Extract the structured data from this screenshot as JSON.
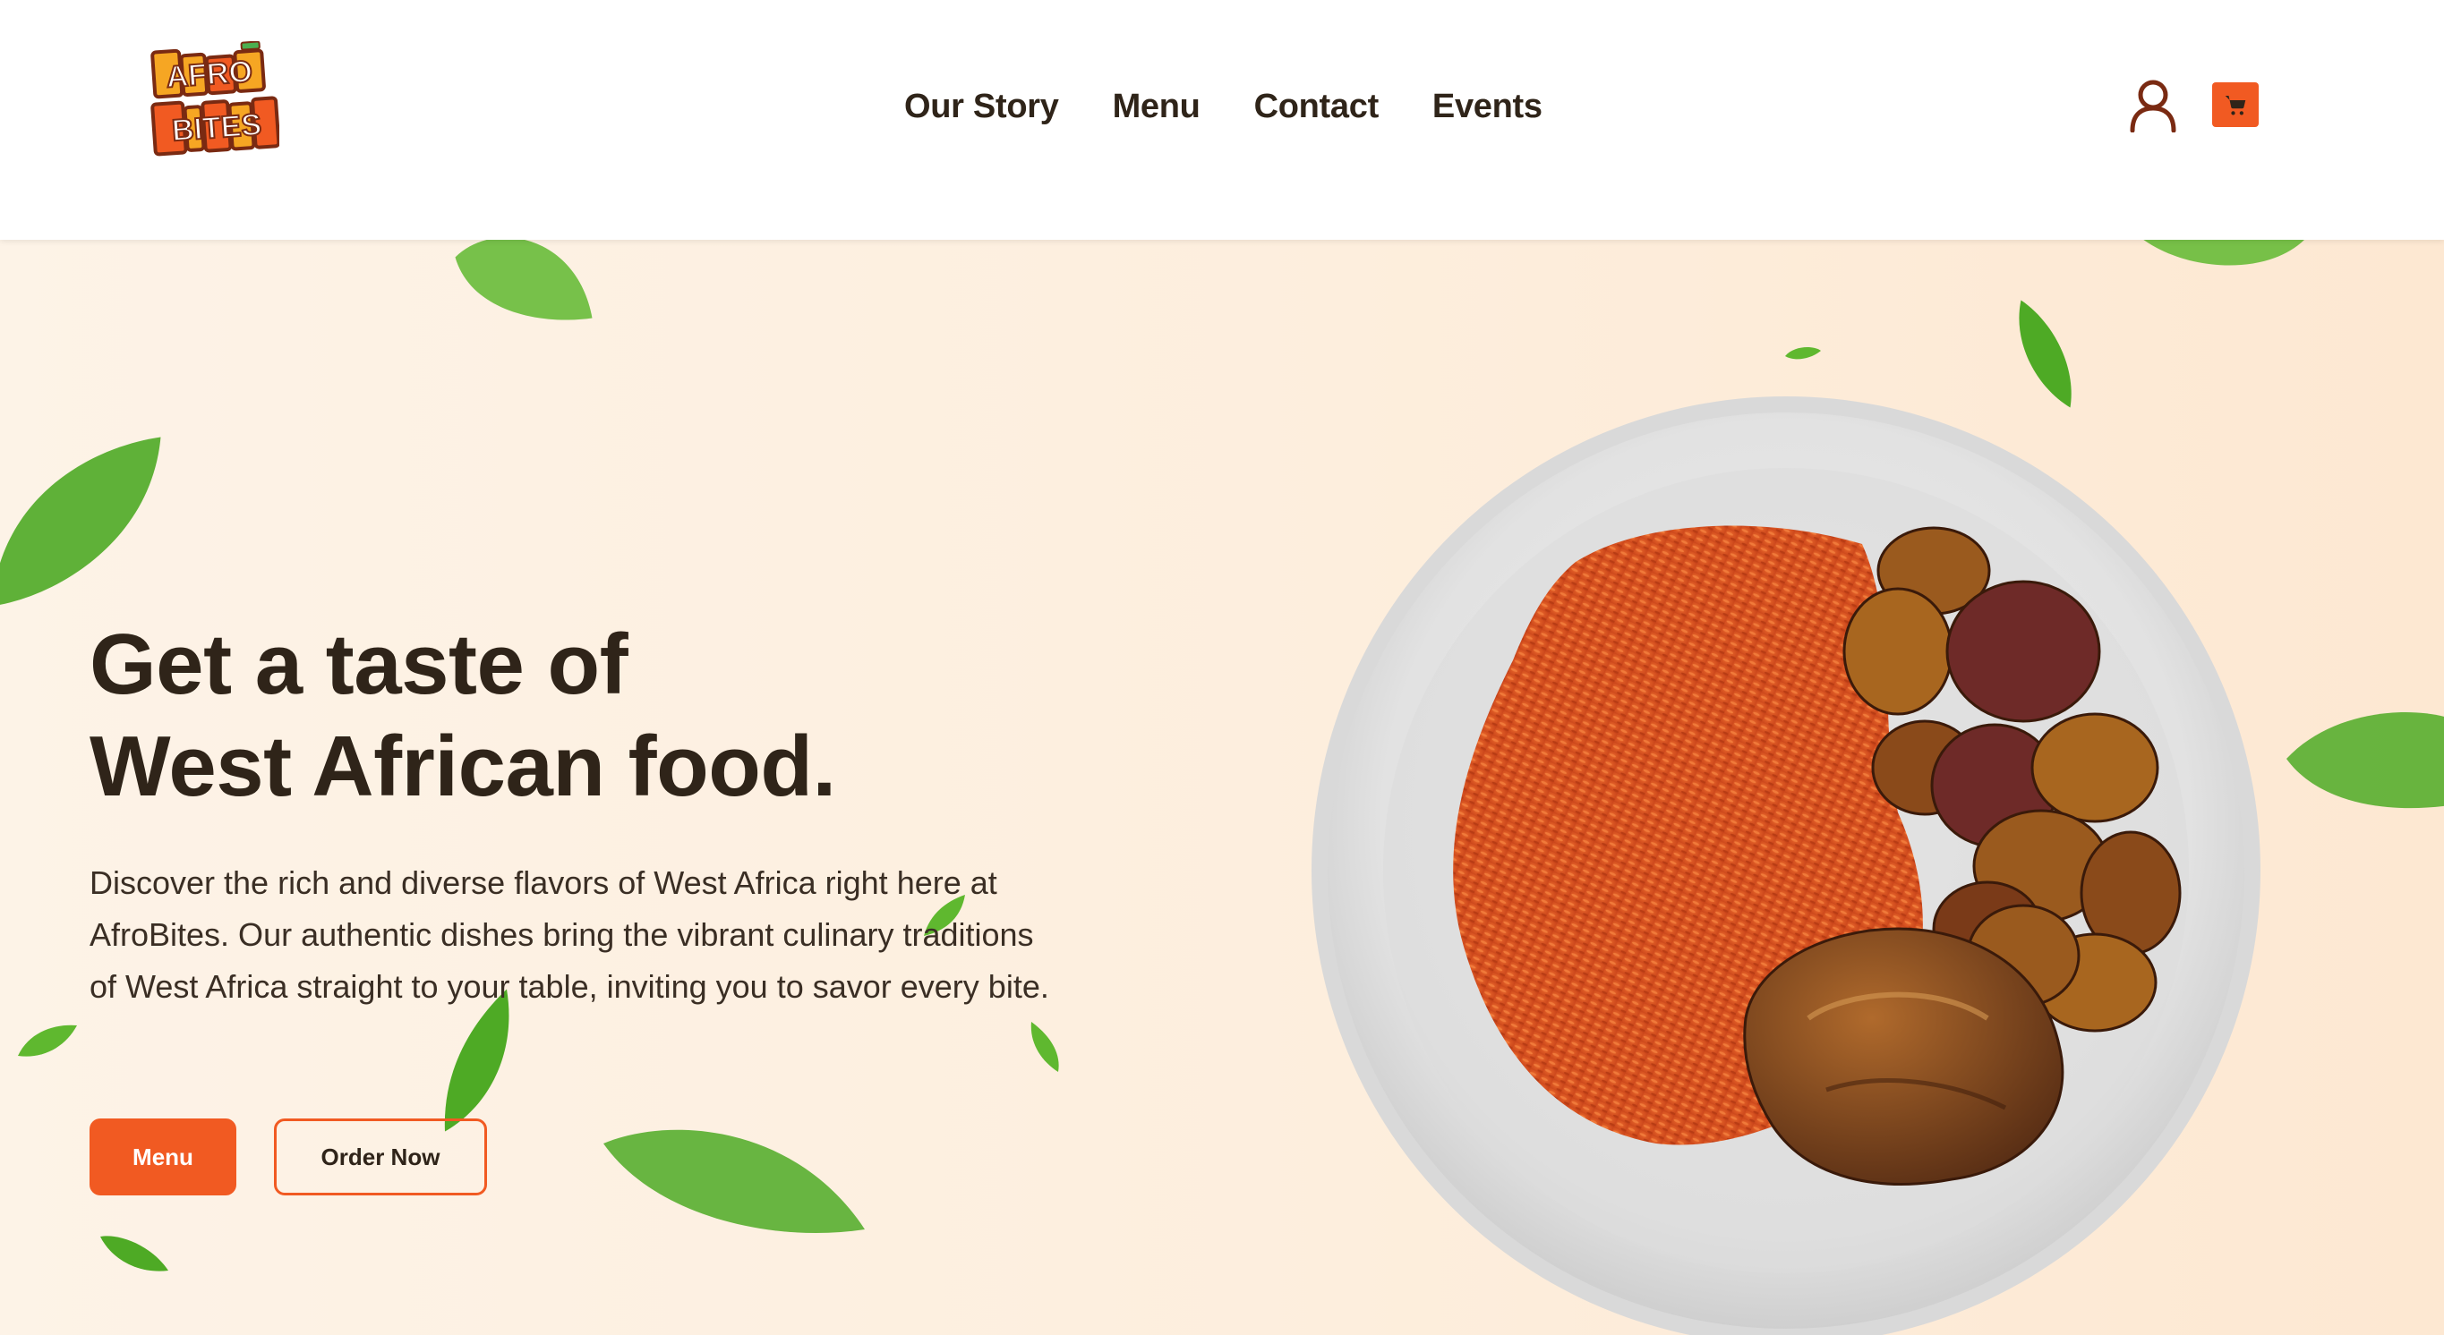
{
  "brand": {
    "logo_name": "AfroBites logo",
    "logo_text_top": "AFRO",
    "logo_text_bottom": "BITES",
    "accent_color": "#f15a22",
    "text_color": "#2f2419",
    "logo_yellow": "#f6a623"
  },
  "nav": {
    "items": [
      {
        "label": "Our Story"
      },
      {
        "label": "Menu"
      },
      {
        "label": "Contact"
      },
      {
        "label": "Events"
      }
    ],
    "user_icon": "user-icon",
    "cart_icon": "cart-icon"
  },
  "hero": {
    "title_line1": "Get a taste of",
    "title_line2": "West African food.",
    "description": "Discover the rich and diverse flavors of West Africa right here at AfroBites. Our authentic dishes bring the vibrant culinary traditions of West Africa straight to your table, inviting you to savor every bite.",
    "primary_button": "Menu",
    "secondary_button": "Order Now",
    "background_color": "#fdf0e2",
    "image_name": "jollof rice with plantains and chicken"
  }
}
